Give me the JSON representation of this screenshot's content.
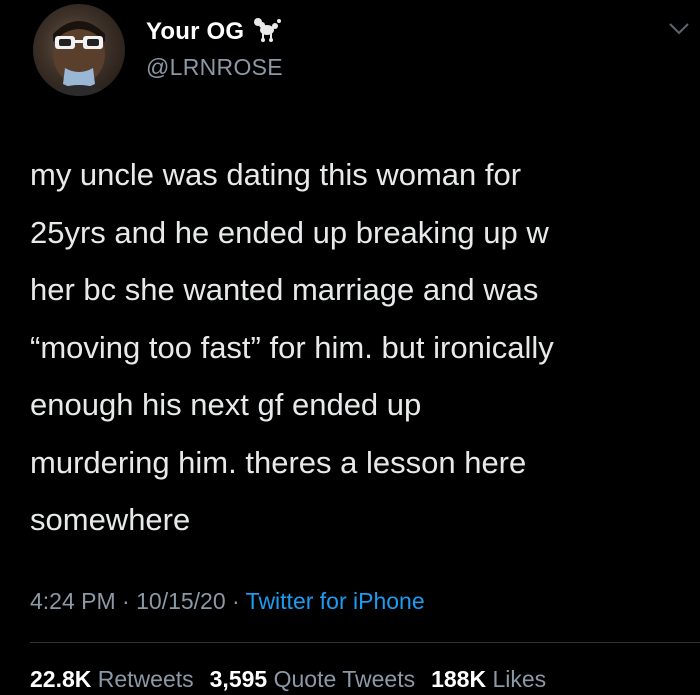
{
  "author": {
    "display_name": "Your OG",
    "name_emoji": "poodle-icon",
    "handle": "@LRNROSE"
  },
  "tweet": {
    "text": "my uncle was dating this woman for\n25yrs and he ended up breaking up w\nher bc she wanted marriage and was\n“moving too fast” for him. but ironically\nenough his next gf ended up\nmurdering him. theres a lesson here\nsomewhere"
  },
  "meta": {
    "time": "4:24 PM",
    "date": "10/15/20",
    "separator": " · ",
    "source": "Twitter for iPhone"
  },
  "stats": {
    "retweets_count": "22.8K",
    "retweets_label": "Retweets",
    "quote_count": "3,595",
    "quote_label": "Quote Tweets",
    "likes_count": "188K",
    "likes_label": "Likes"
  },
  "colors": {
    "background": "#000000",
    "text": "#e7e9ea",
    "secondary": "#8b98a5",
    "link": "#1d9bf0"
  }
}
